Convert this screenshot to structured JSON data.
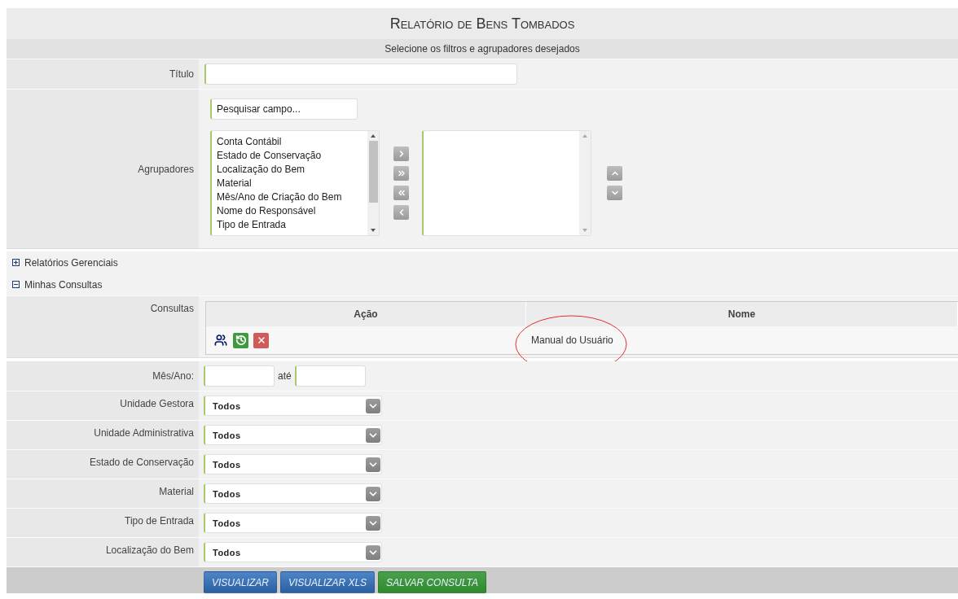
{
  "header": {
    "title": "Relatório de Bens Tombados",
    "subtitle": "Selecione os filtros e agrupadores desejados"
  },
  "titulo": {
    "label": "Título"
  },
  "agrupadores": {
    "label": "Agrupadores",
    "search": {
      "placeholder": "Pesquisar campo..."
    },
    "available": [
      "Conta Contábil",
      "Estado de Conservação",
      "Localização do Bem",
      "Material",
      "Mês/Ano de Criação do Bem",
      "Nome do Responsável",
      "Tipo de Entrada"
    ]
  },
  "sections": [
    {
      "label": "Relatórios Gerenciais",
      "expanded": false
    },
    {
      "label": "Minhas Consultas",
      "expanded": true
    }
  ],
  "consultas": {
    "label": "Consultas",
    "columns": [
      "Ação",
      "Nome"
    ],
    "rows": [
      {
        "name": "Manual do Usuário"
      }
    ]
  },
  "filters": [
    {
      "kind": "period",
      "label": "Mês/Ano:",
      "separator": "até"
    },
    {
      "kind": "select",
      "label": "Unidade Gestora",
      "value": "Todos"
    },
    {
      "kind": "select",
      "label": "Unidade Administrativa",
      "value": "Todos"
    },
    {
      "kind": "select",
      "label": "Estado de Conservação",
      "value": "Todos"
    },
    {
      "kind": "select",
      "label": "Material",
      "value": "Todos"
    },
    {
      "kind": "select",
      "label": "Tipo de Entrada",
      "value": "Todos"
    },
    {
      "kind": "select",
      "label": "Localização do Bem",
      "value": "Todos"
    }
  ],
  "buttons": [
    {
      "label": "VISUALIZAR",
      "kind": "primary"
    },
    {
      "label": "VISUALIZAR XLS",
      "kind": "primary"
    },
    {
      "label": "SALVAR CONSULTA",
      "kind": "success"
    }
  ]
}
